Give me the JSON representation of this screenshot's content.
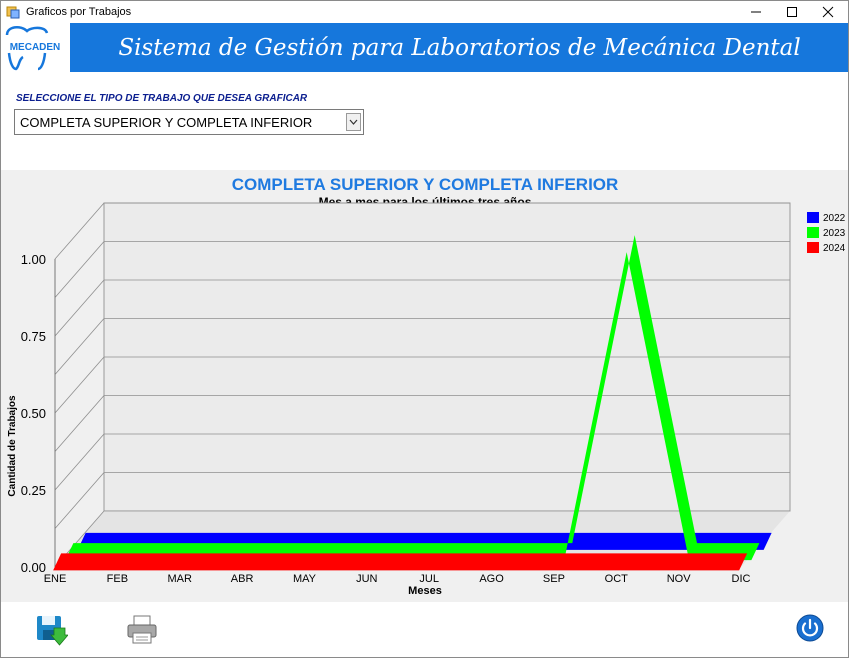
{
  "window": {
    "title": "Graficos por Trabajos"
  },
  "banner": {
    "logo_text": "MECADEN",
    "title": "Sistema de Gestión para Laboratorios de Mecánica Dental"
  },
  "selector": {
    "label": "SELECCIONE EL TIPO DE TRABAJO QUE DESEA GRAFICAR",
    "value": "COMPLETA SUPERIOR Y COMPLETA INFERIOR"
  },
  "colors": {
    "accent": "#1677dc",
    "title_blue": "#1f7ae0",
    "series_2022": "#0000ff",
    "series_2023": "#00ff00",
    "series_2024": "#ff0000"
  },
  "icons": {
    "save": "save-icon",
    "print": "printer-icon",
    "power": "power-icon"
  },
  "chart_data": {
    "type": "line",
    "title": "COMPLETA SUPERIOR Y COMPLETA INFERIOR",
    "subtitle": "Mes a mes para los últimos tres años",
    "xlabel": "Meses",
    "ylabel": "Cantidad de Trabajos",
    "categories": [
      "ENE",
      "FEB",
      "MAR",
      "ABR",
      "MAY",
      "JUN",
      "JUL",
      "AGO",
      "SEP",
      "OCT",
      "NOV",
      "DIC"
    ],
    "ylim": [
      0,
      1
    ],
    "yticks": [
      "0.00",
      "0.25",
      "0.50",
      "0.75",
      "1.00"
    ],
    "grid": true,
    "legend_position": "top-right",
    "series": [
      {
        "name": "2022",
        "color": "#0000ff",
        "values": [
          0,
          0,
          0,
          0,
          0,
          0,
          0,
          0,
          0,
          0,
          0,
          0
        ]
      },
      {
        "name": "2023",
        "color": "#00ff00",
        "values": [
          0,
          0,
          0,
          0,
          0,
          0,
          0,
          0,
          0,
          1,
          0,
          0
        ]
      },
      {
        "name": "2024",
        "color": "#ff0000",
        "values": [
          0,
          0,
          0,
          0,
          0,
          0,
          0,
          0,
          0,
          0,
          0,
          0
        ]
      }
    ]
  }
}
